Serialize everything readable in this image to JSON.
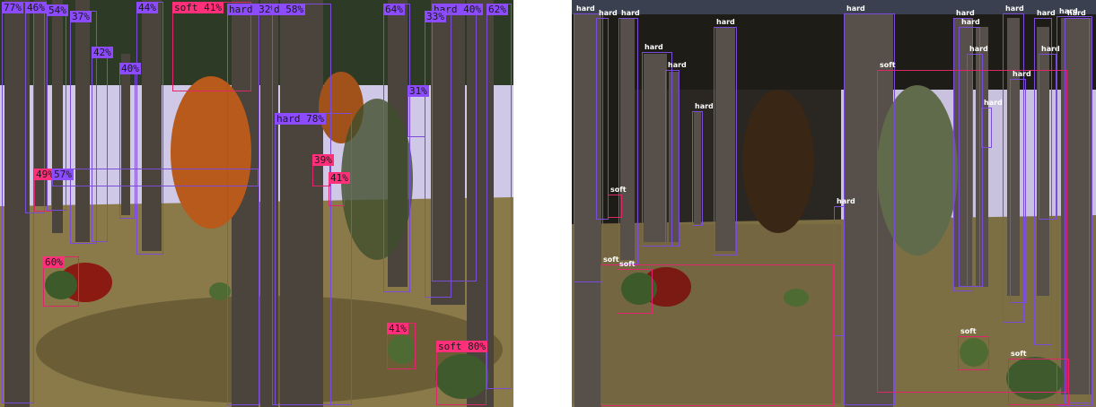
{
  "colors": {
    "hard_box": "#7a4cd8",
    "soft_box": "#e0266a",
    "hard_tag": "#8c4bff",
    "soft_tag": "#ff2f7a",
    "sky": "#cfc8e6",
    "ground": "#8a7a4a",
    "trunk": "#4a443d",
    "foliage_orange": "#b85a1c",
    "foliage_green": "#4f6b34"
  },
  "left_panel": {
    "detections": [
      {
        "label": "77%",
        "cls": "hard"
      },
      {
        "label": "46%",
        "cls": "hard"
      },
      {
        "label": "54%",
        "cls": "hard"
      },
      {
        "label": "37%",
        "cls": "hard"
      },
      {
        "label": "44%",
        "cls": "hard"
      },
      {
        "label": "soft 41%",
        "cls": "soft"
      },
      {
        "label": "hard 32%",
        "cls": "hard"
      },
      {
        "label": "d 58%",
        "cls": "hard"
      },
      {
        "label": "64%",
        "cls": "hard"
      },
      {
        "label": "hard 40%",
        "cls": "hard"
      },
      {
        "label": "62%",
        "cls": "hard"
      },
      {
        "label": "33%",
        "cls": "hard"
      },
      {
        "label": "42%",
        "cls": "hard"
      },
      {
        "label": "40%",
        "cls": "hard"
      },
      {
        "label": "31%",
        "cls": "hard"
      },
      {
        "label": "hard 78%",
        "cls": "hard"
      },
      {
        "label": "39%",
        "cls": "soft"
      },
      {
        "label": "41%",
        "cls": "soft"
      },
      {
        "label": "49%",
        "cls": "soft"
      },
      {
        "label": "57%",
        "cls": "hard"
      },
      {
        "label": "60%",
        "cls": "soft"
      },
      {
        "label": "41%",
        "cls": "soft"
      },
      {
        "label": "soft 80%",
        "cls": "soft"
      }
    ]
  },
  "right_panel": {
    "detections": [
      {
        "label": "hard",
        "cls": "hard"
      },
      {
        "label": "hard",
        "cls": "hard"
      },
      {
        "label": "hard",
        "cls": "hard"
      },
      {
        "label": "hard",
        "cls": "hard"
      },
      {
        "label": "hard",
        "cls": "hard"
      },
      {
        "label": "hard",
        "cls": "hard"
      },
      {
        "label": "hard",
        "cls": "hard"
      },
      {
        "label": "hard",
        "cls": "hard"
      },
      {
        "label": "hard",
        "cls": "hard"
      },
      {
        "label": "hard",
        "cls": "hard"
      },
      {
        "label": "hard",
        "cls": "hard"
      },
      {
        "label": "hard",
        "cls": "hard"
      },
      {
        "label": "hard",
        "cls": "hard"
      },
      {
        "label": "hard",
        "cls": "hard"
      },
      {
        "label": "hard",
        "cls": "hard"
      },
      {
        "label": "hard",
        "cls": "hard"
      },
      {
        "label": "hard",
        "cls": "hard"
      },
      {
        "label": "hard",
        "cls": "hard"
      },
      {
        "label": "hard",
        "cls": "hard"
      },
      {
        "label": "soft",
        "cls": "soft"
      },
      {
        "label": "soft",
        "cls": "soft"
      },
      {
        "label": "soft",
        "cls": "soft"
      },
      {
        "label": "soft",
        "cls": "soft"
      },
      {
        "label": "soft",
        "cls": "soft"
      },
      {
        "label": "soft",
        "cls": "soft"
      }
    ]
  }
}
